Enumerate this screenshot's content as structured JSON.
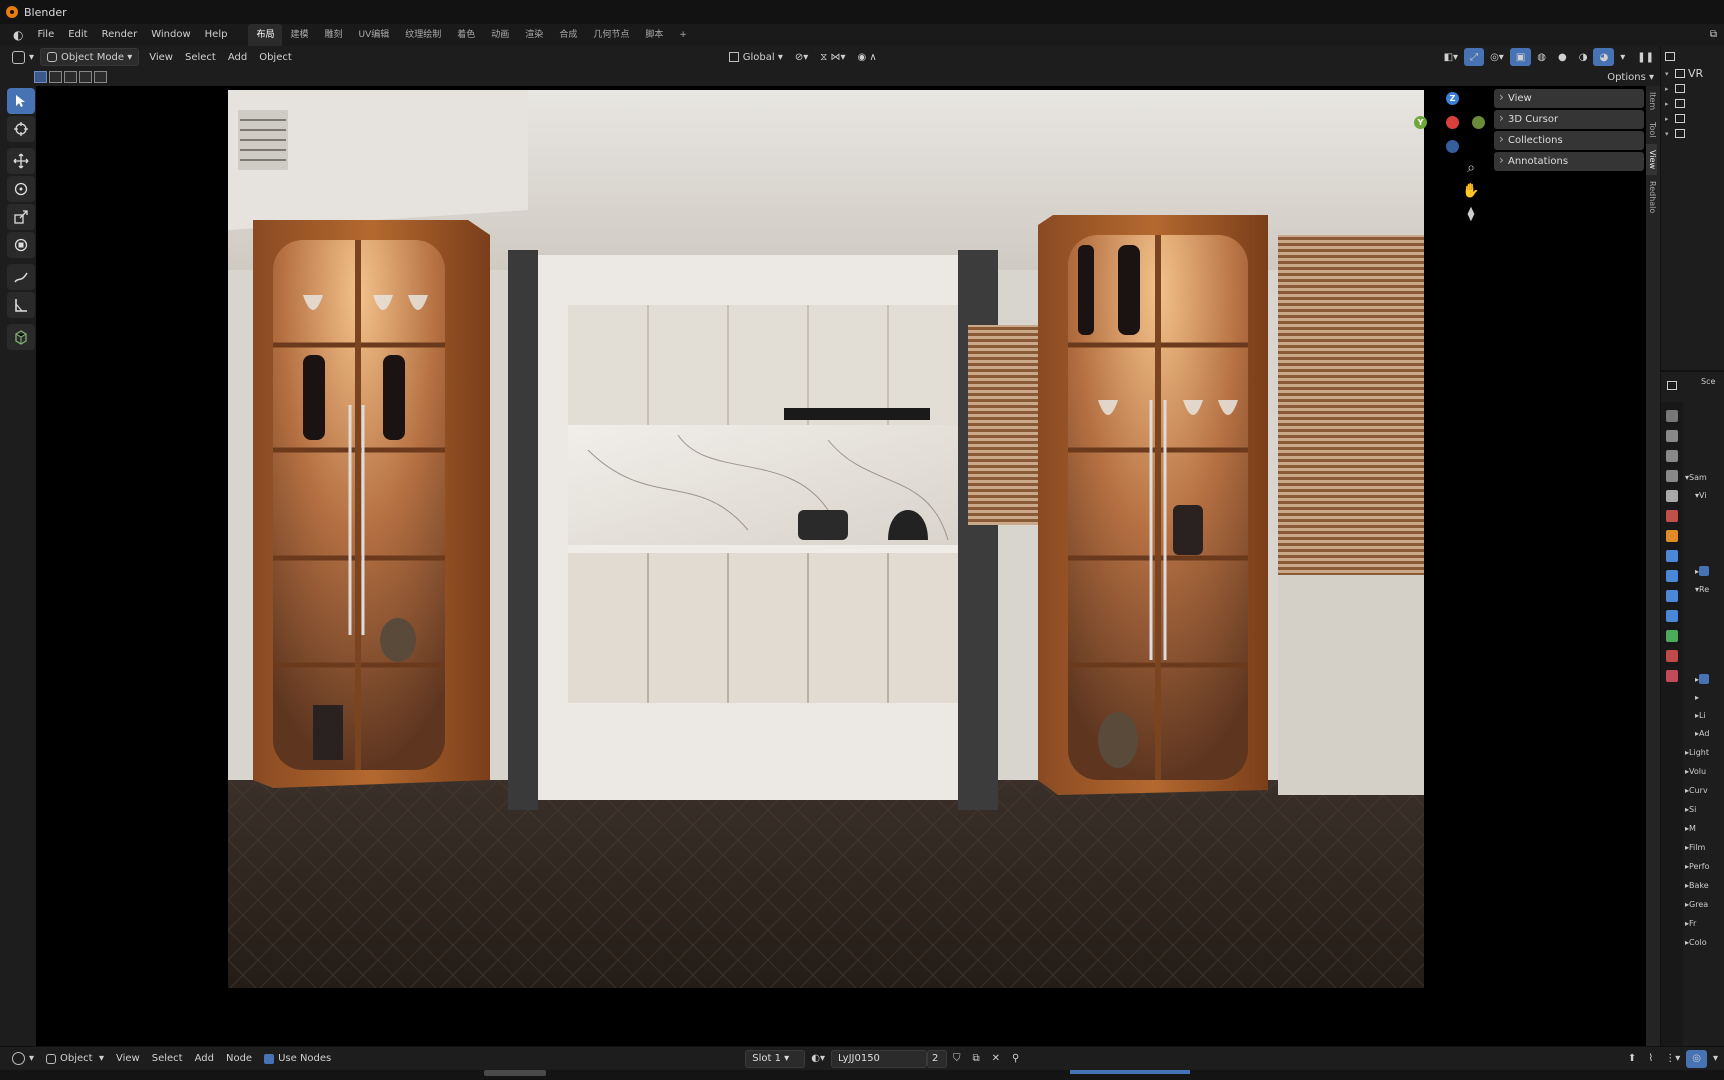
{
  "window": {
    "title": "Blender"
  },
  "menu": {
    "items": [
      "File",
      "Edit",
      "Render",
      "Window",
      "Help"
    ],
    "workspaces": [
      "布局",
      "建模",
      "雕刻",
      "UV编辑",
      "纹理绘制",
      "着色",
      "动画",
      "渲染",
      "合成",
      "几何节点",
      "脚本"
    ],
    "add_workspace": "+"
  },
  "header": {
    "mode": "Object Mode",
    "view": "View",
    "select": "Select",
    "add": "Add",
    "object": "Object",
    "orientation": "Global",
    "options": "Options"
  },
  "npanel": {
    "sections": [
      "View",
      "3D Cursor",
      "Collections",
      "Annotations"
    ],
    "tabs": [
      "Item",
      "Tool",
      "View",
      "Redhalo"
    ]
  },
  "outliner": {
    "root": "VR"
  },
  "properties": {
    "top_label": "Sce",
    "rows": [
      "Sam",
      "Vi",
      "Re",
      "Li",
      "Ad",
      "Light",
      "Volu",
      "Curv",
      "Si",
      "M",
      "Film",
      "Perfo",
      "Bake",
      "Grea",
      "Fr",
      "Colo"
    ]
  },
  "gizmo": {
    "z": "Z",
    "y": "Y"
  },
  "node_header": {
    "editor_mode": "Object",
    "view": "View",
    "select": "Select",
    "add": "Add",
    "node": "Node",
    "use_nodes": "Use Nodes",
    "slot": "Slot 1",
    "material": "LyJJ0150",
    "user_count": "2"
  }
}
